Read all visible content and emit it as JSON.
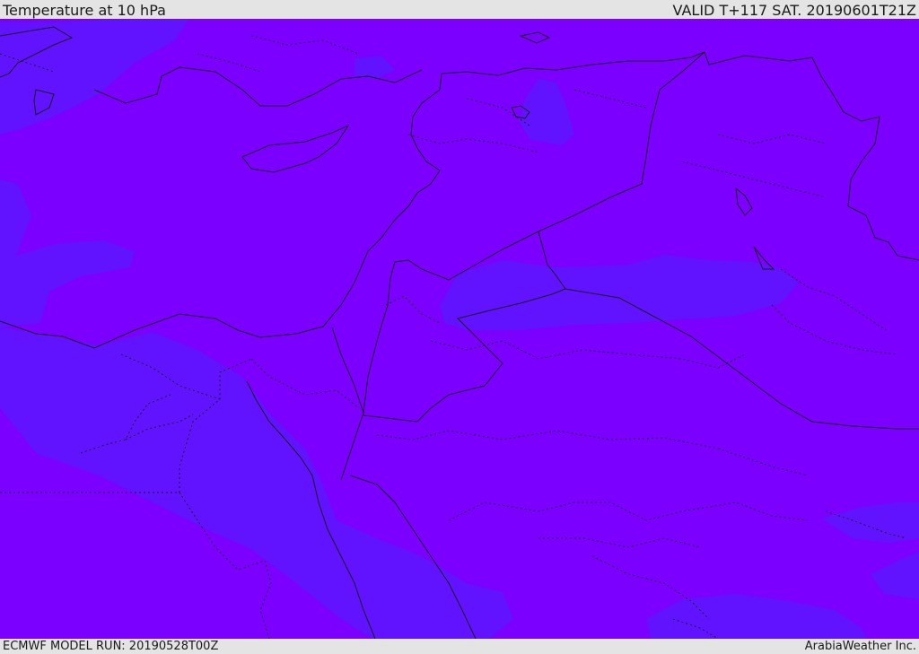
{
  "header": {
    "title": "Temperature at 10 hPa",
    "valid": "VALID T+117 SAT. 20190601T21Z"
  },
  "footer": {
    "model_run": "ECMWF MODEL RUN: 20190528T00Z",
    "credit": "ArabiaWeather Inc."
  },
  "colors": {
    "band_warm": "#7b00ff",
    "band_cool": "#6112ff",
    "background": "#e4e4e4",
    "border_line": "#1a1a1a"
  }
}
